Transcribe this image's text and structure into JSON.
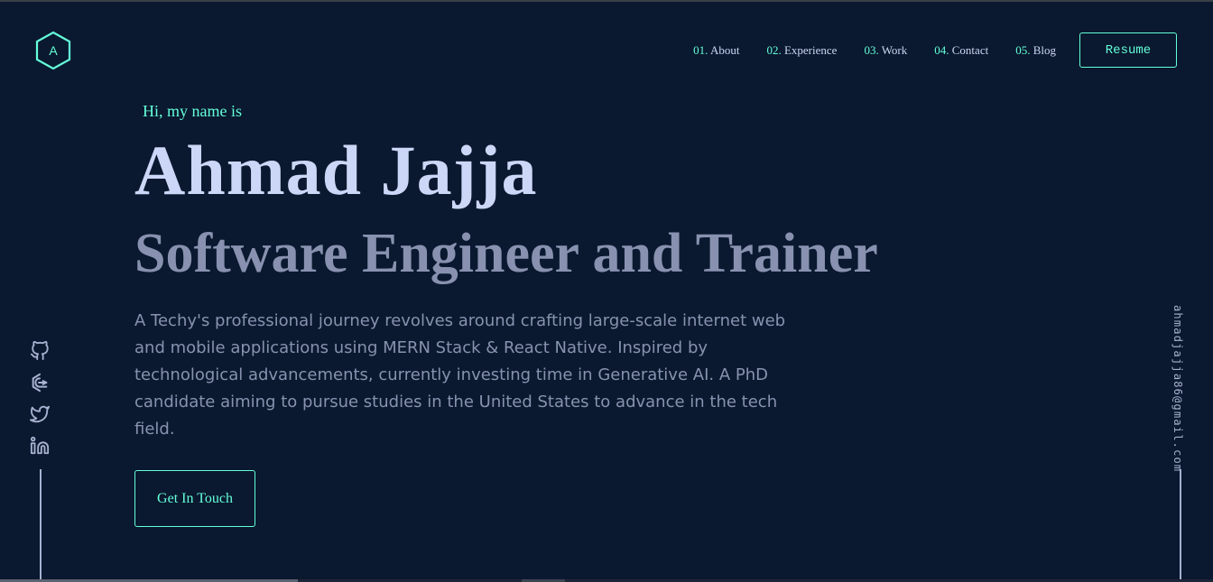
{
  "logo": {
    "letter": "A",
    "icon": "hexagon-logo-icon"
  },
  "nav": {
    "items": [
      {
        "num": "01.",
        "label": "About"
      },
      {
        "num": "02.",
        "label": "Experience"
      },
      {
        "num": "03.",
        "label": "Work"
      },
      {
        "num": "04.",
        "label": "Contact"
      },
      {
        "num": "05.",
        "label": "Blog"
      }
    ],
    "resume_label": "Resume"
  },
  "hero": {
    "greeting": "Hi, my name is",
    "name": "Ahmad Jajja",
    "tagline": "Software Engineer and Trainer",
    "bio": "A Techy's professional journey revolves around crafting large-scale internet web and mobile applications using MERN Stack & React Native. Inspired by technological advancements, currently investing time in Generative AI. A PhD candidate aiming to pursue studies in the United States to advance in the tech field.",
    "cta_label": "Get In Touch"
  },
  "social": {
    "icons": [
      "github-icon",
      "codepen-icon",
      "twitter-icon",
      "linkedin-icon"
    ]
  },
  "email": "ahmadjajja86@gmail.com",
  "colors": {
    "background": "#0a192f",
    "accent": "#64ffda",
    "heading": "#ccd6f6",
    "muted": "#8892b0",
    "light": "#a8b2d1"
  }
}
